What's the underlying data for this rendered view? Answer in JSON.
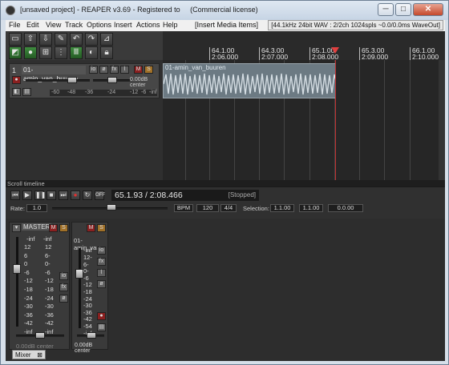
{
  "window": {
    "title": "[unsaved project] - REAPER v3.69 - Registered to",
    "license": "(Commercial license)",
    "minimize": "─",
    "maximize": "□",
    "close": "✕"
  },
  "menu": {
    "items": [
      "File",
      "Edit",
      "View",
      "Track",
      "Options",
      "Insert",
      "Actions",
      "Help"
    ],
    "insert_media": "[Insert Media Items]",
    "audio_status": "[44.1kHz 24bit WAV : 2/2ch 1024spls ~0.0/0.0ms WaveOut]"
  },
  "track": {
    "number": "1",
    "name": "01-amin_van_buuren",
    "pan_label": "0.00dB center",
    "meter_labels": [
      "-60",
      "-48",
      "-36",
      "-24",
      "-12",
      "-6",
      "-inf"
    ],
    "volume_db": 0.0
  },
  "timeline": {
    "markers": [
      {
        "bar": "64.1.00",
        "time": "2:06.000"
      },
      {
        "bar": "64.3.00",
        "time": "2:07.000"
      },
      {
        "bar": "65.1.00",
        "time": "2:08.000"
      },
      {
        "bar": "65.3.00",
        "time": "2:09.000"
      },
      {
        "bar": "66.1.00",
        "time": "2:10.000"
      }
    ]
  },
  "media_item": {
    "name": "01-amin_van_buuren"
  },
  "scroll_label": "Scroll timeline",
  "transport": {
    "time": "65.1.93 / 2:08.466",
    "state": "[Stopped]",
    "rate_label": "Rate:",
    "rate_value": "1.0",
    "bpm_label": "BPM",
    "bpm_value": "120",
    "time_sig": "4/4",
    "selection_label": "Selection:",
    "sel_start": "1.1.00",
    "sel_end": "1.1.00",
    "sel_len": "0.0.00",
    "off_label": "OFF"
  },
  "mixer": {
    "master_label": "MASTER",
    "master_peaks": [
      "-inf",
      "-inf"
    ],
    "master_scale": [
      "12",
      "6",
      "0",
      "-6",
      "-12",
      "-18",
      "-24",
      "-30",
      "-36",
      "-42",
      "-inf"
    ],
    "master_scale_right": [
      "12",
      "6-",
      "0-",
      "-6",
      "-12",
      "-18",
      "-24",
      "-30",
      "-36",
      "-42",
      "-inf"
    ],
    "master_vol_label": "0.00dB center",
    "track_name": "01-amin_van",
    "track_peak": "-inf",
    "track_vol_label": "0.00dB center",
    "track_scale": [
      "-inf",
      "12-",
      "6-",
      "0-",
      "-6",
      "-12",
      "-18",
      "-24",
      "-30",
      "-36",
      "-42",
      "-54",
      "-inf"
    ],
    "tab_label": "Mixer"
  },
  "toolbar_icons": [
    "new-project-icon",
    "open-project-icon",
    "save-project-icon",
    "project-settings-icon",
    "undo-icon",
    "redo-icon",
    "metronome-icon",
    "grid-snap-icon",
    "ripple-icon",
    "grid-icon",
    "envelope-icon",
    "lock-icon",
    "crossfade-icon"
  ]
}
